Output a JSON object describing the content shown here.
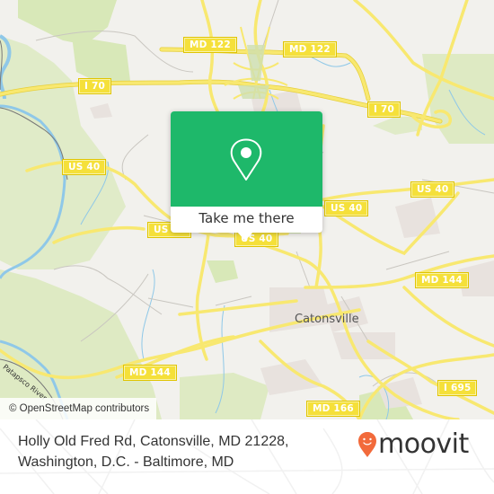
{
  "map": {
    "road_labels": [
      {
        "id": "md122-a",
        "text": "MD 122"
      },
      {
        "id": "md122-b",
        "text": "MD 122"
      },
      {
        "id": "i70-a",
        "text": "I 70"
      },
      {
        "id": "i70-b",
        "text": "I 70"
      },
      {
        "id": "us40-a",
        "text": "US 40"
      },
      {
        "id": "us40-b",
        "text": "US 40"
      },
      {
        "id": "us40-c",
        "text": "US 40"
      },
      {
        "id": "us40-d",
        "text": "US 40"
      },
      {
        "id": "us40-e",
        "text": "US 40"
      },
      {
        "id": "md144-a",
        "text": "MD 144"
      },
      {
        "id": "md144-b",
        "text": "MD 144"
      },
      {
        "id": "i695",
        "text": "I 695"
      },
      {
        "id": "md166",
        "text": "MD 166"
      }
    ],
    "place_label": "Catonsville",
    "river_label": "Patapsco River",
    "attribution": "© OpenStreetMap contributors",
    "colors": {
      "background": "#f2f1ed",
      "park": "#d8e8b8",
      "road_major": "#f5e03a",
      "water": "#8fc8e8",
      "urban": "#e8e2de"
    }
  },
  "popup": {
    "button_label": "Take me there",
    "icon": "location-pin-icon",
    "color": "#1eb86a"
  },
  "footer": {
    "address_line1": "Holly Old Fred Rd, Catonsville, MD 21228,",
    "address_line2": "Washington, D.C. - Baltimore, MD",
    "logo_text": "moovit",
    "logo_color": "#f26a3b"
  }
}
